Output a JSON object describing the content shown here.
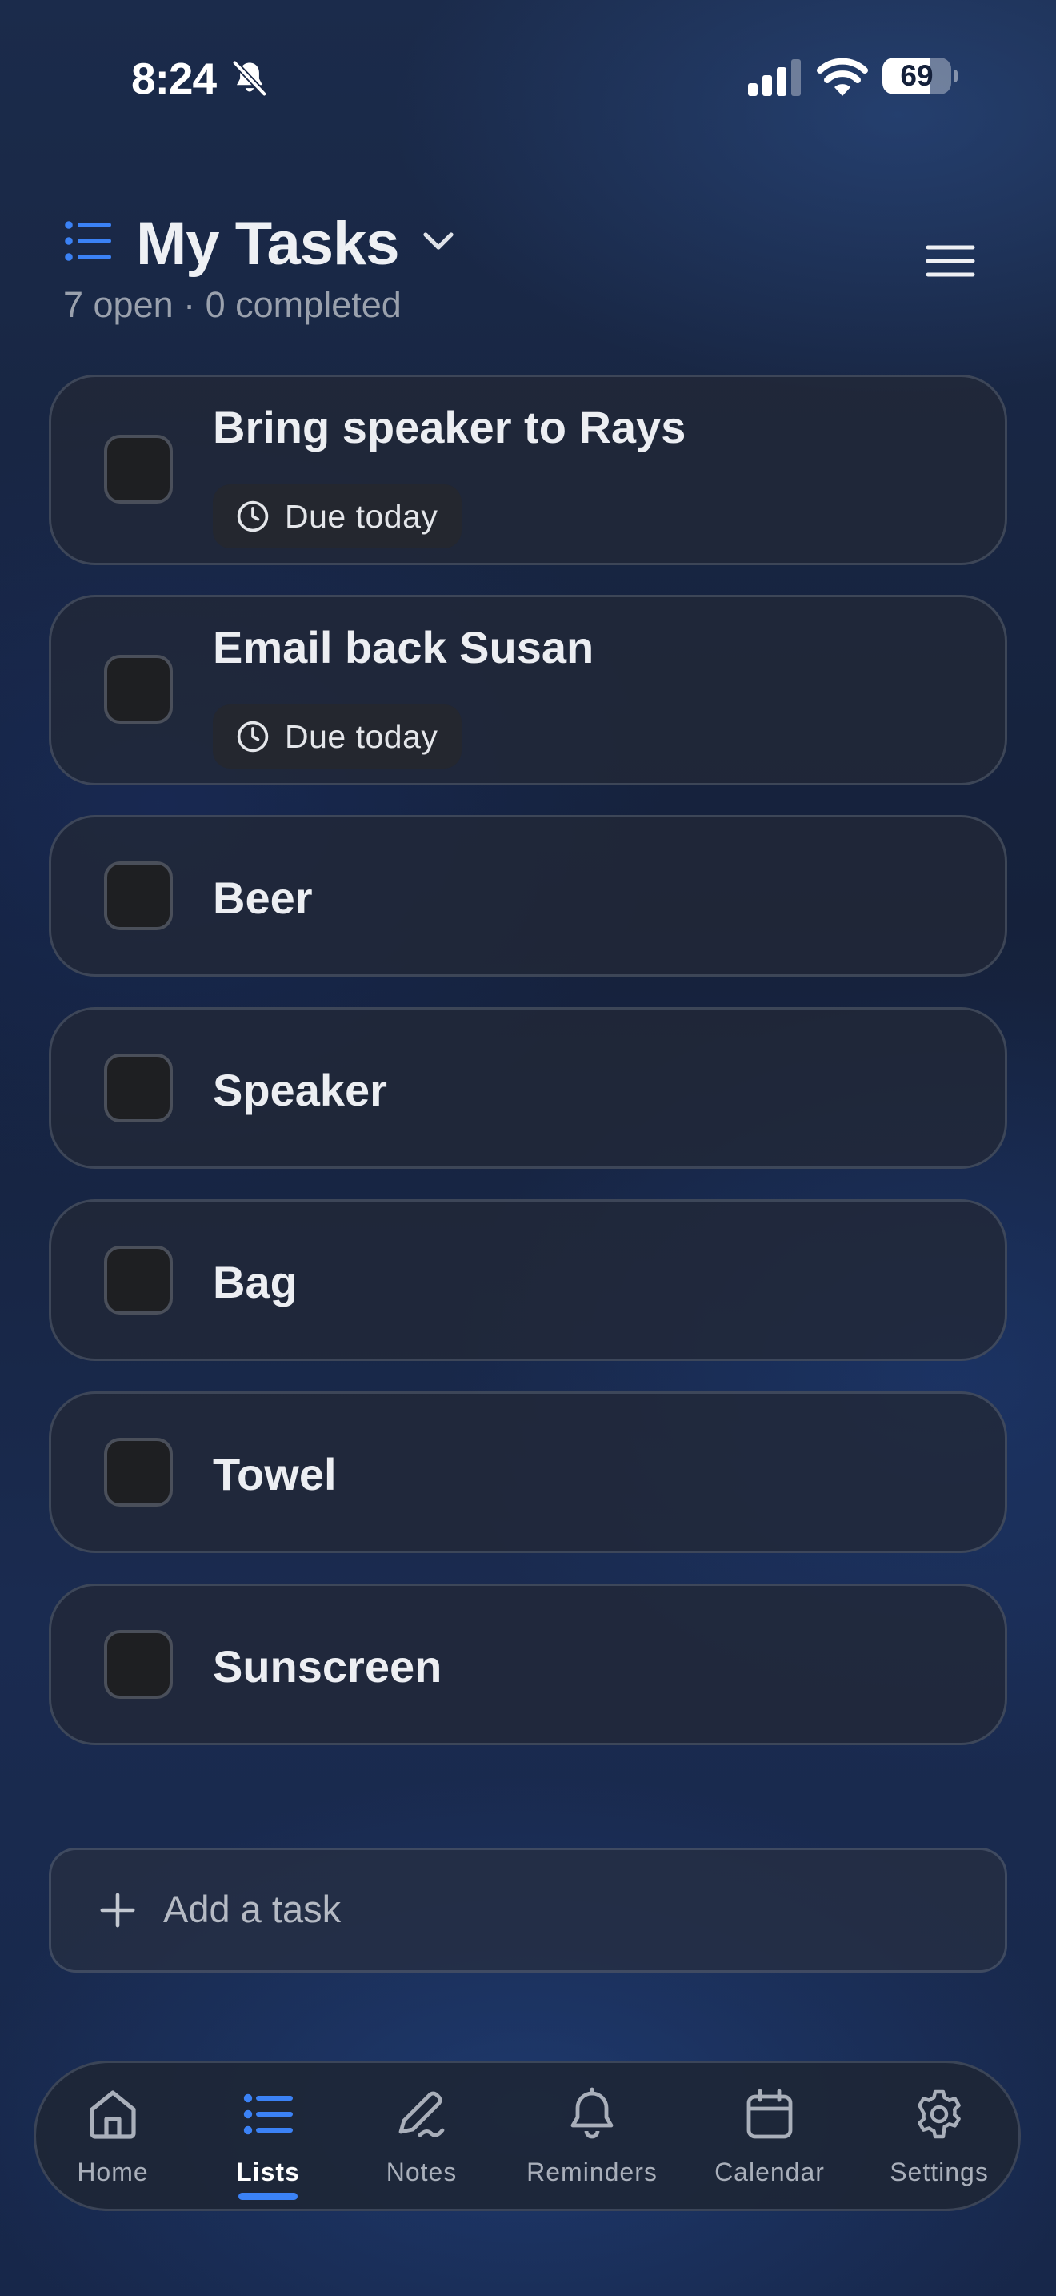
{
  "status_bar": {
    "time": "8:24",
    "battery_level": "69"
  },
  "header": {
    "title": "My Tasks",
    "subtitle": "7 open · 0 completed",
    "list_icon": "list-icon",
    "menu_icon": "hamburger-menu-icon"
  },
  "tasks": [
    {
      "title": "Bring speaker to Rays",
      "due": "Due today"
    },
    {
      "title": "Email back Susan",
      "due": "Due today"
    },
    {
      "title": "Beer"
    },
    {
      "title": "Speaker"
    },
    {
      "title": "Bag"
    },
    {
      "title": "Towel"
    },
    {
      "title": "Sunscreen"
    }
  ],
  "add_task": {
    "label": "Add a task"
  },
  "tab_bar": {
    "tabs": [
      {
        "label": "Home",
        "icon": "home-icon"
      },
      {
        "label": "Lists",
        "icon": "list-icon",
        "active": true
      },
      {
        "label": "Notes",
        "icon": "pen-icon"
      },
      {
        "label": "Reminders",
        "icon": "bell-icon"
      },
      {
        "label": "Calendar",
        "icon": "calendar-icon"
      },
      {
        "label": "Settings",
        "icon": "gear-icon"
      }
    ]
  },
  "colors": {
    "accent": "#3b82f6",
    "card_bg": "#222837",
    "text_primary": "#eceef2",
    "text_secondary": "#9aa1ad"
  }
}
